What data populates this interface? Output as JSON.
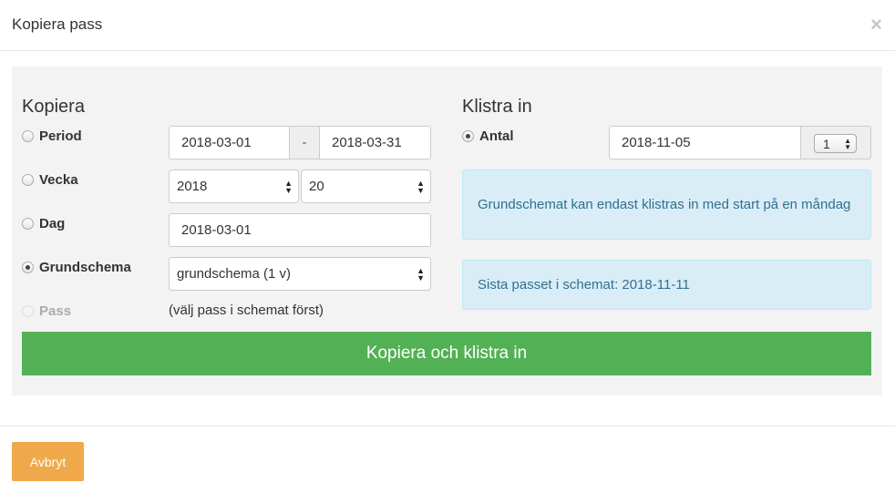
{
  "modal": {
    "title": "Kopiera pass",
    "close_glyph": "×"
  },
  "copy": {
    "heading": "Kopiera",
    "period": {
      "label": "Period",
      "from": "2018-03-01",
      "separator": "-",
      "to": "2018-03-31",
      "checked": false
    },
    "week": {
      "label": "Vecka",
      "year": "2018",
      "week": "20",
      "checked": false
    },
    "day": {
      "label": "Dag",
      "date": "2018-03-01",
      "checked": false
    },
    "base_schedule": {
      "label": "Grundschema",
      "selected": "grundschema (1 v)",
      "checked": true
    },
    "pass": {
      "label": "Pass",
      "hint": "(välj pass i schemat först)",
      "checked": false,
      "disabled": true
    }
  },
  "paste": {
    "heading": "Klistra in",
    "count": {
      "label": "Antal",
      "start_date": "2018-11-05",
      "count_value": "1",
      "checked": true
    },
    "info_monday": "Grundschemat kan endast klistras in med start på en måndag",
    "info_last": "Sista passet i schemat: 2018-11-11"
  },
  "actions": {
    "copy_paste_label": "Kopiera och klistra in",
    "cancel_label": "Avbryt"
  },
  "colors": {
    "primary_green": "#53b155",
    "cancel_orange": "#f0a94a",
    "info_bg": "#d9edf7",
    "info_text": "#31708f",
    "panel_bg": "#f3f3f3"
  },
  "icons": {
    "close": "close-icon",
    "select_arrows": "select-arrows-icon",
    "radio": "radio-icon"
  }
}
